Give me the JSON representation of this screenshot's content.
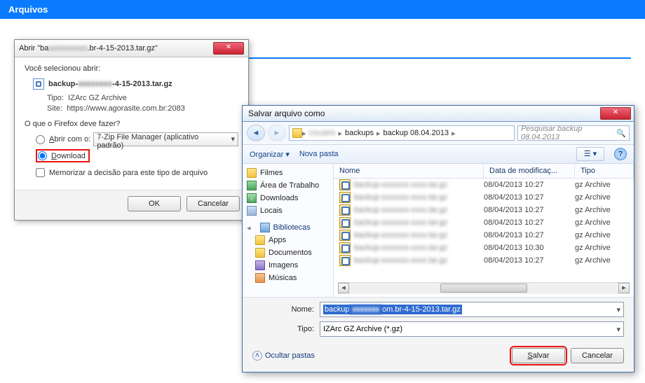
{
  "page": {
    "title": "Arquivos"
  },
  "ff": {
    "title_prefix": "Abrir \"ba",
    "title_suffix": ".br-4-15-2013.tar.gz\"",
    "you_selected": "Você selecionou abrir:",
    "file_prefix": "backup-",
    "file_suffix": "-4-15-2013.tar.gz",
    "type_label": "Tipo:",
    "type_value": "IZArc GZ Archive",
    "site_label": "Site:",
    "site_value": "https://www.agorasite.com.br:2083",
    "what_do": "O que o Firefox deve fazer?",
    "open_with_pre": "A",
    "open_with_u": "brir com o:",
    "open_with_app": "7-Zip File Manager (aplicativo padrão)",
    "download_pre": "D",
    "download_rest": "ownload",
    "remember_pre": "Memorizar a decisão para este tipo de arquivo",
    "ok": "OK",
    "cancel": "Cancelar"
  },
  "save": {
    "title": "Salvar arquivo como",
    "breadcrumb": {
      "seg1": "backups",
      "seg2": "backup 08.04.2013"
    },
    "search_placeholder": "Pesquisar backup 08.04.2013",
    "organize": "Organizar",
    "new_folder": "Nova pasta",
    "tree": {
      "filmes": "Filmes",
      "desktop": "Área de Trabalho",
      "downloads": "Downloads",
      "locais": "Locais",
      "bibliotecas": "Bibliotecas",
      "apps": "Apps",
      "documentos": "Documentos",
      "imagens": "Imagens",
      "musicas": "Músicas"
    },
    "cols": {
      "name": "Nome",
      "date": "Data de modificaç...",
      "type": "Tipo"
    },
    "rows": [
      {
        "date": "08/04/2013 10:27",
        "type": "gz Archive"
      },
      {
        "date": "08/04/2013 10:27",
        "type": "gz Archive"
      },
      {
        "date": "08/04/2013 10:27",
        "type": "gz Archive"
      },
      {
        "date": "08/04/2013 10:27",
        "type": "gz Archive"
      },
      {
        "date": "08/04/2013 10:27",
        "type": "gz Archive"
      },
      {
        "date": "08/04/2013 10:30",
        "type": "gz Archive"
      },
      {
        "date": "08/04/2013 10:27",
        "type": "gz Archive"
      }
    ],
    "name_label": "Nome:",
    "name_value_prefix": "backup",
    "name_value_suffix": "om.br-4-15-2013.tar.gz",
    "type_label": "Tipo:",
    "type_value": "IZArc GZ Archive (*.gz)",
    "hide_folders": "Ocultar pastas",
    "save_btn_u": "S",
    "save_btn_rest": "alvar",
    "cancel": "Cancelar"
  }
}
